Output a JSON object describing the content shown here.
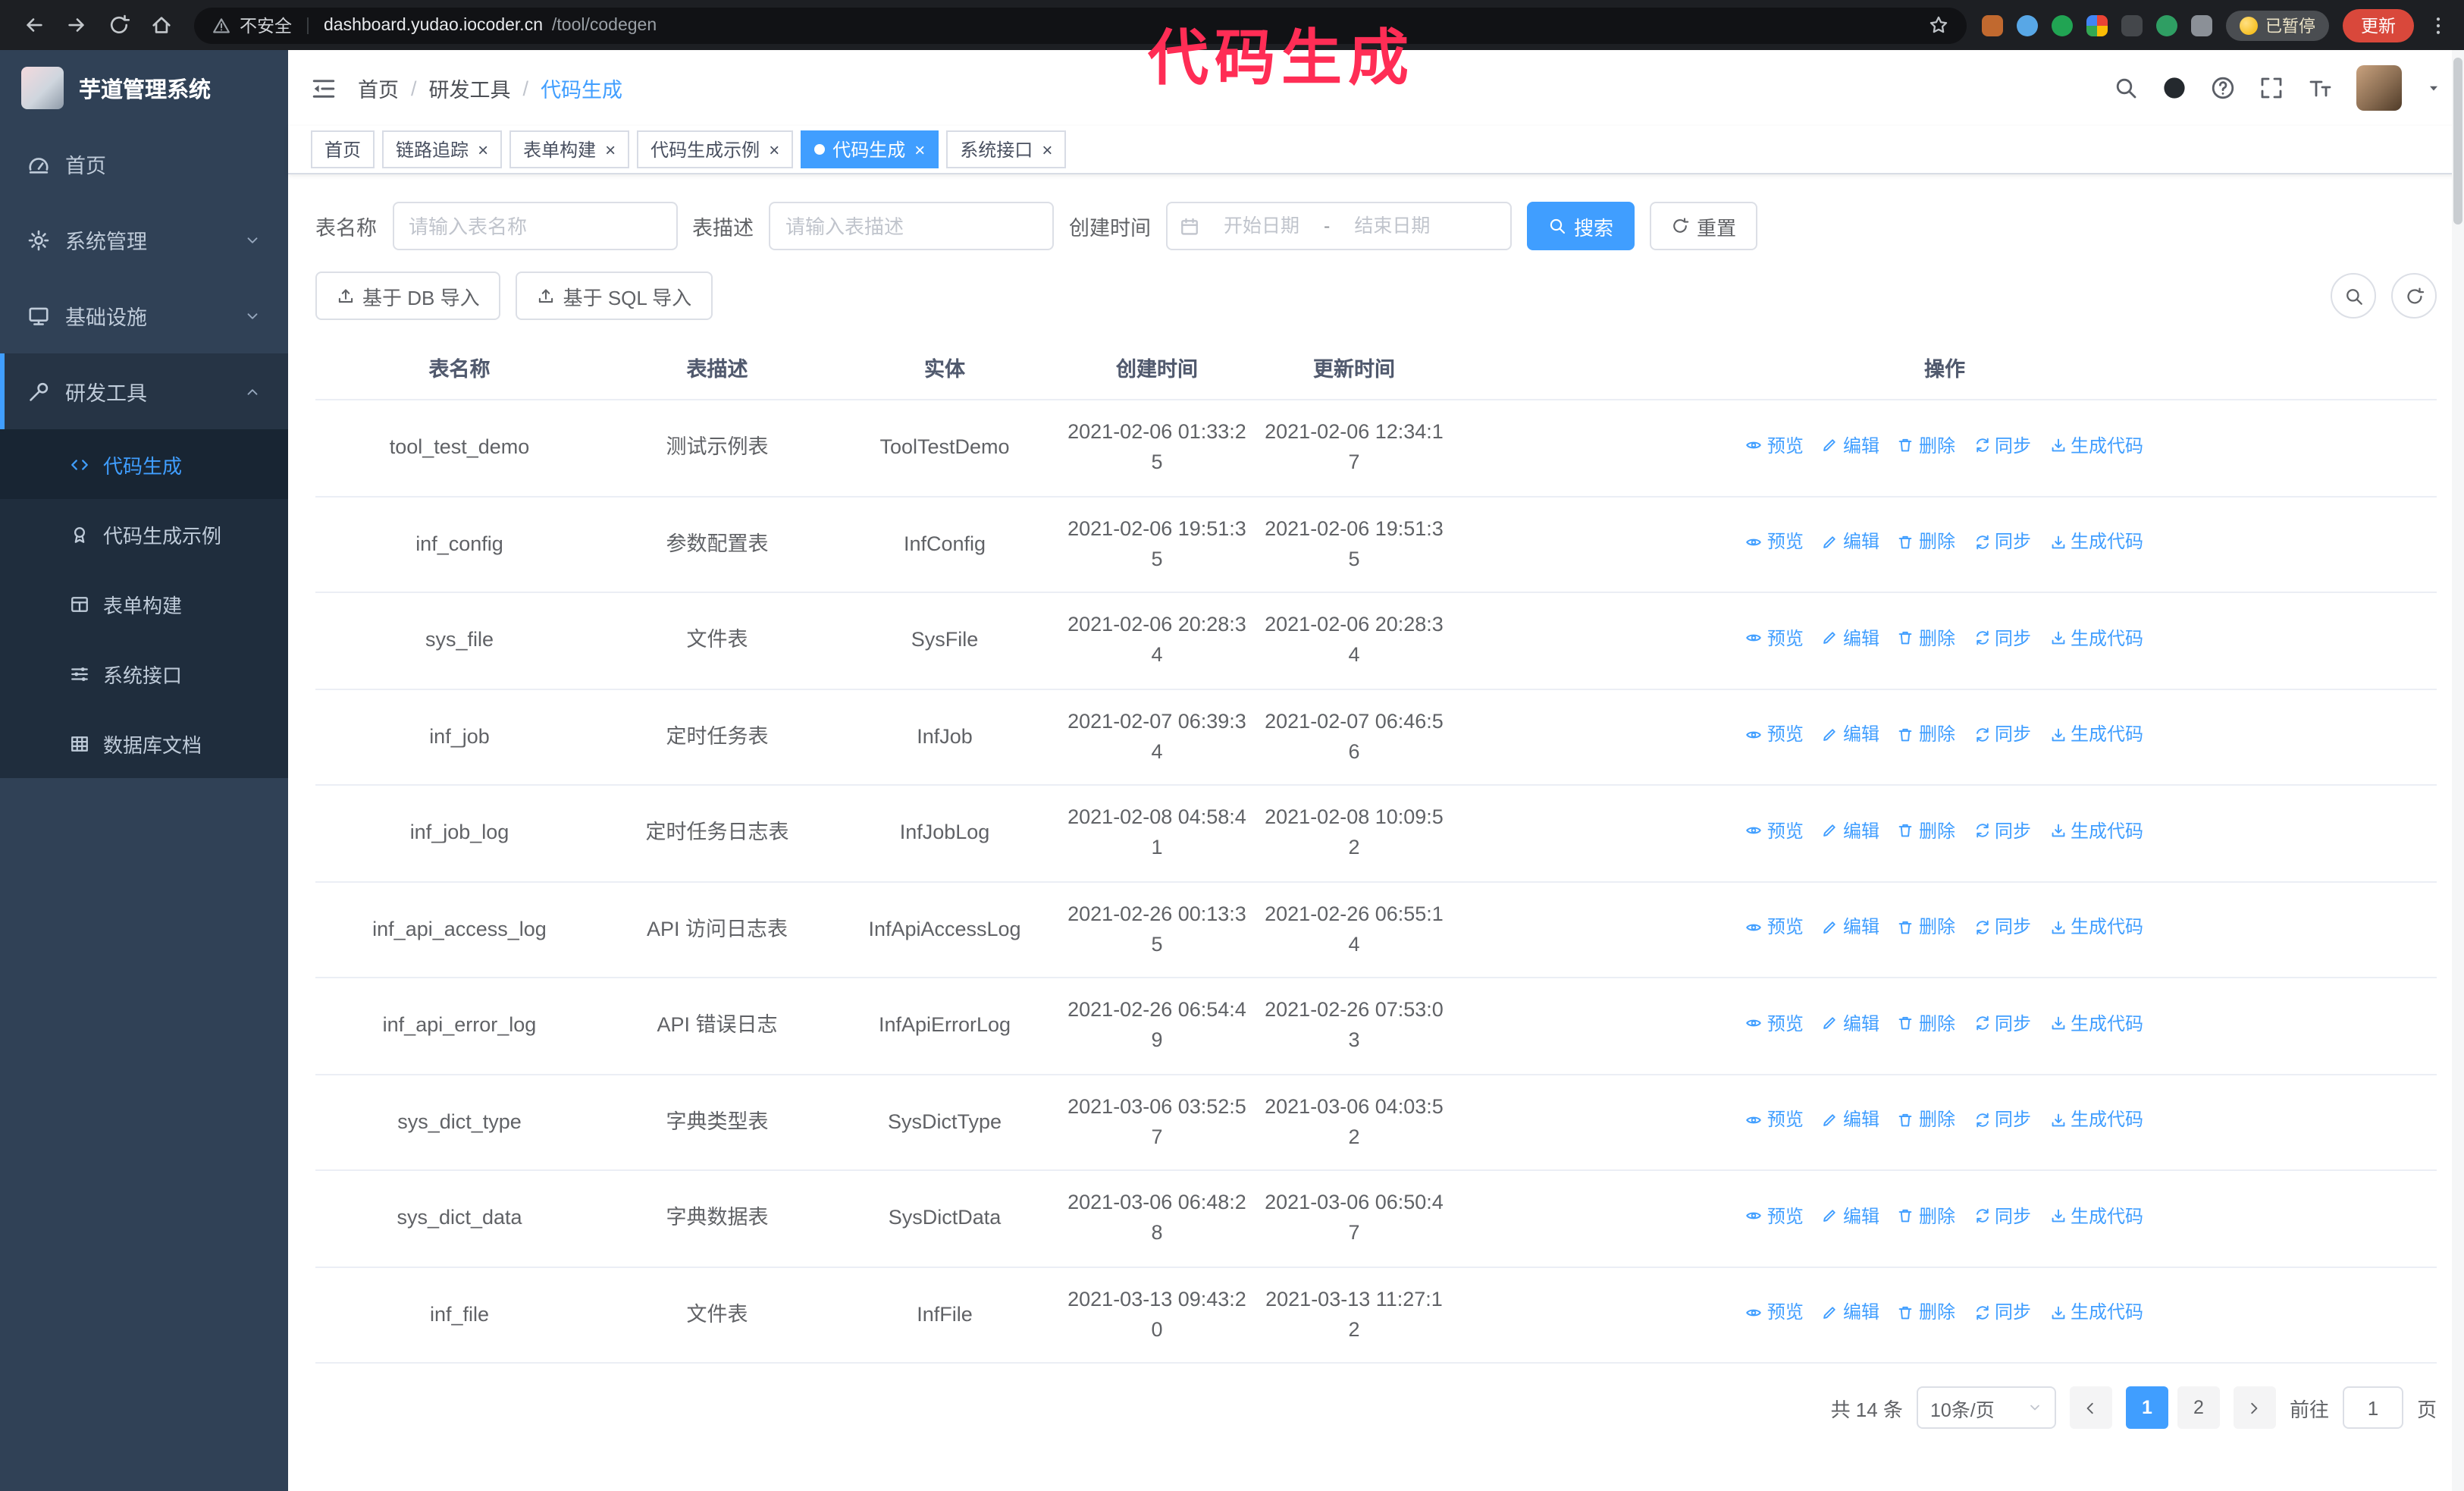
{
  "annotation": {
    "text": "代码生成",
    "color": "#ff2d55"
  },
  "browser": {
    "security_label": "不安全",
    "url_host": "dashboard.yudao.iocoder.cn",
    "url_path": "/tool/codegen",
    "paused_label": "已暂停",
    "update_label": "更新",
    "extensions": [
      {
        "name": "ext-orange",
        "color": "#c1692f"
      },
      {
        "name": "ext-blue",
        "color": "#58a7e6",
        "round": true
      },
      {
        "name": "ext-green-check",
        "color": "#21a453",
        "round": true
      },
      {
        "name": "ext-color-grid",
        "grid": true
      },
      {
        "name": "ext-dark",
        "color": "#44474b"
      },
      {
        "name": "ext-green",
        "color": "#2f9e63",
        "round": true
      },
      {
        "name": "ext-puzzle",
        "color": "#8b9097"
      }
    ]
  },
  "sidebar": {
    "title": "芋道管理系统",
    "items": [
      {
        "key": "home",
        "label": "首页",
        "icon": "gauge"
      },
      {
        "key": "system",
        "label": "系统管理",
        "icon": "gear",
        "arrow": "down"
      },
      {
        "key": "infra",
        "label": "基础设施",
        "icon": "monitor",
        "arrow": "down"
      },
      {
        "key": "devtools",
        "label": "研发工具",
        "icon": "tool",
        "arrow": "up",
        "open": true
      }
    ],
    "subitems": [
      {
        "key": "codegen",
        "label": "代码生成",
        "icon": "code",
        "active": true
      },
      {
        "key": "codegen-demo",
        "label": "代码生成示例",
        "icon": "badge"
      },
      {
        "key": "form-builder",
        "label": "表单构建",
        "icon": "formtable"
      },
      {
        "key": "system-api",
        "label": "系统接口",
        "icon": "api"
      },
      {
        "key": "db-doc",
        "label": "数据库文档",
        "icon": "grid"
      }
    ]
  },
  "header": {
    "breadcrumb": [
      "首页",
      "研发工具",
      "代码生成"
    ],
    "separator": "/"
  },
  "tabbar": {
    "close_glyph": "×",
    "tabs": [
      {
        "key": "home",
        "label": "首页"
      },
      {
        "key": "tracing",
        "label": "链路追踪",
        "closable": true
      },
      {
        "key": "form-builder",
        "label": "表单构建",
        "closable": true
      },
      {
        "key": "codegen-demo",
        "label": "代码生成示例",
        "closable": true
      },
      {
        "key": "codegen",
        "label": "代码生成",
        "closable": true,
        "active": true
      },
      {
        "key": "system-api",
        "label": "系统接口",
        "closable": true
      }
    ]
  },
  "filters": {
    "name_label": "表名称",
    "name_placeholder": "请输入表名称",
    "desc_label": "表描述",
    "desc_placeholder": "请输入表描述",
    "time_label": "创建时间",
    "start_placeholder": "开始日期",
    "range_separator": "-",
    "end_placeholder": "结束日期",
    "search_label": "搜索",
    "reset_label": "重置"
  },
  "toolbar": {
    "import_db_label": "基于 DB 导入",
    "import_sql_label": "基于 SQL 导入"
  },
  "table": {
    "columns": [
      {
        "key": "name",
        "label": "表名称"
      },
      {
        "key": "desc",
        "label": "表描述"
      },
      {
        "key": "entity",
        "label": "实体"
      },
      {
        "key": "created",
        "label": "创建时间"
      },
      {
        "key": "updated",
        "label": "更新时间"
      },
      {
        "key": "ops",
        "label": "操作"
      }
    ],
    "actions": [
      {
        "key": "preview",
        "label": "预览",
        "icon": "eye"
      },
      {
        "key": "edit",
        "label": "编辑",
        "icon": "edit"
      },
      {
        "key": "delete",
        "label": "删除",
        "icon": "trash"
      },
      {
        "key": "sync",
        "label": "同步",
        "icon": "sync"
      },
      {
        "key": "generate-code",
        "label": "生成代码",
        "icon": "download"
      }
    ],
    "rows": [
      {
        "name": "tool_test_demo",
        "desc": "测试示例表",
        "entity": "ToolTestDemo",
        "created": "2021-02-06 01:33:25",
        "updated": "2021-02-06 12:34:17"
      },
      {
        "name": "inf_config",
        "desc": "参数配置表",
        "entity": "InfConfig",
        "created": "2021-02-06 19:51:35",
        "updated": "2021-02-06 19:51:35"
      },
      {
        "name": "sys_file",
        "desc": "文件表",
        "entity": "SysFile",
        "created": "2021-02-06 20:28:34",
        "updated": "2021-02-06 20:28:34"
      },
      {
        "name": "inf_job",
        "desc": "定时任务表",
        "entity": "InfJob",
        "created": "2021-02-07 06:39:34",
        "updated": "2021-02-07 06:46:56"
      },
      {
        "name": "inf_job_log",
        "desc": "定时任务日志表",
        "entity": "InfJobLog",
        "created": "2021-02-08 04:58:41",
        "updated": "2021-02-08 10:09:52"
      },
      {
        "name": "inf_api_access_log",
        "desc": "API 访问日志表",
        "entity": "InfApiAccessLog",
        "created": "2021-02-26 00:13:35",
        "updated": "2021-02-26 06:55:14"
      },
      {
        "name": "inf_api_error_log",
        "desc": "API 错误日志",
        "entity": "InfApiErrorLog",
        "created": "2021-02-26 06:54:49",
        "updated": "2021-02-26 07:53:03"
      },
      {
        "name": "sys_dict_type",
        "desc": "字典类型表",
        "entity": "SysDictType",
        "created": "2021-03-06 03:52:57",
        "updated": "2021-03-06 04:03:52"
      },
      {
        "name": "sys_dict_data",
        "desc": "字典数据表",
        "entity": "SysDictData",
        "created": "2021-03-06 06:48:28",
        "updated": "2021-03-06 06:50:47"
      },
      {
        "name": "inf_file",
        "desc": "文件表",
        "entity": "InfFile",
        "created": "2021-03-13 09:43:20",
        "updated": "2021-03-13 11:27:12"
      }
    ]
  },
  "pagination": {
    "total": "共 14 条",
    "page_size": "10条/页",
    "pages": [
      "1",
      "2"
    ],
    "active_page": "1",
    "goto_label": "前往",
    "goto_value": "1",
    "goto_unit": "页"
  }
}
